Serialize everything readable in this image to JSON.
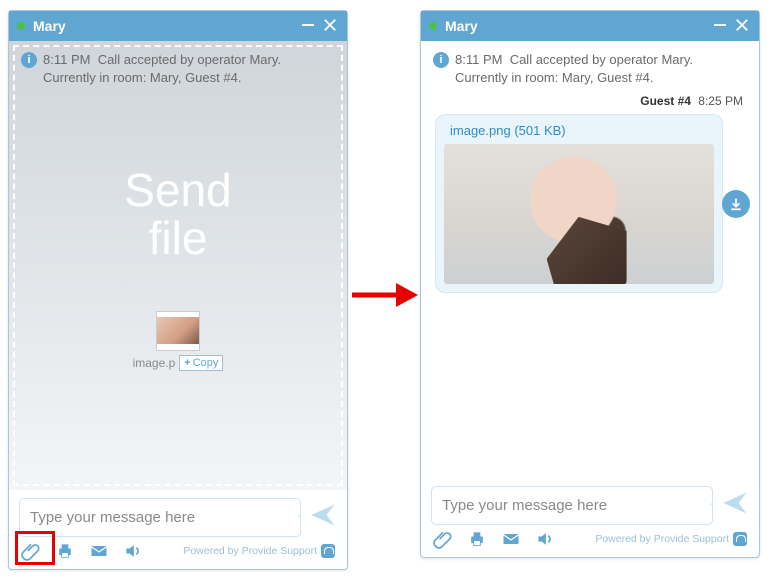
{
  "left": {
    "title": "Mary",
    "sys_time": "8:11 PM",
    "sys_line1": "Call accepted by operator Mary.",
    "sys_line2": "Currently in room: Mary, Guest #4.",
    "sendfile_l1": "Send",
    "sendfile_l2": "file",
    "drop_filename": "image.p",
    "copy_label": "Copy",
    "input_placeholder": "Type your message here",
    "powered": "Powered by Provide Support"
  },
  "right": {
    "title": "Mary",
    "sys_time": "8:11 PM",
    "sys_line1": "Call accepted by operator Mary.",
    "sys_line2": "Currently in room: Mary, Guest #4.",
    "msg_sender": "Guest #4",
    "msg_time": "8:25 PM",
    "attachment_label": "image.png (501 KB)",
    "input_placeholder": "Type your message here",
    "powered": "Powered by Provide Support"
  },
  "colors": {
    "accent": "#5fa6d3",
    "arrow": "#e80000"
  }
}
